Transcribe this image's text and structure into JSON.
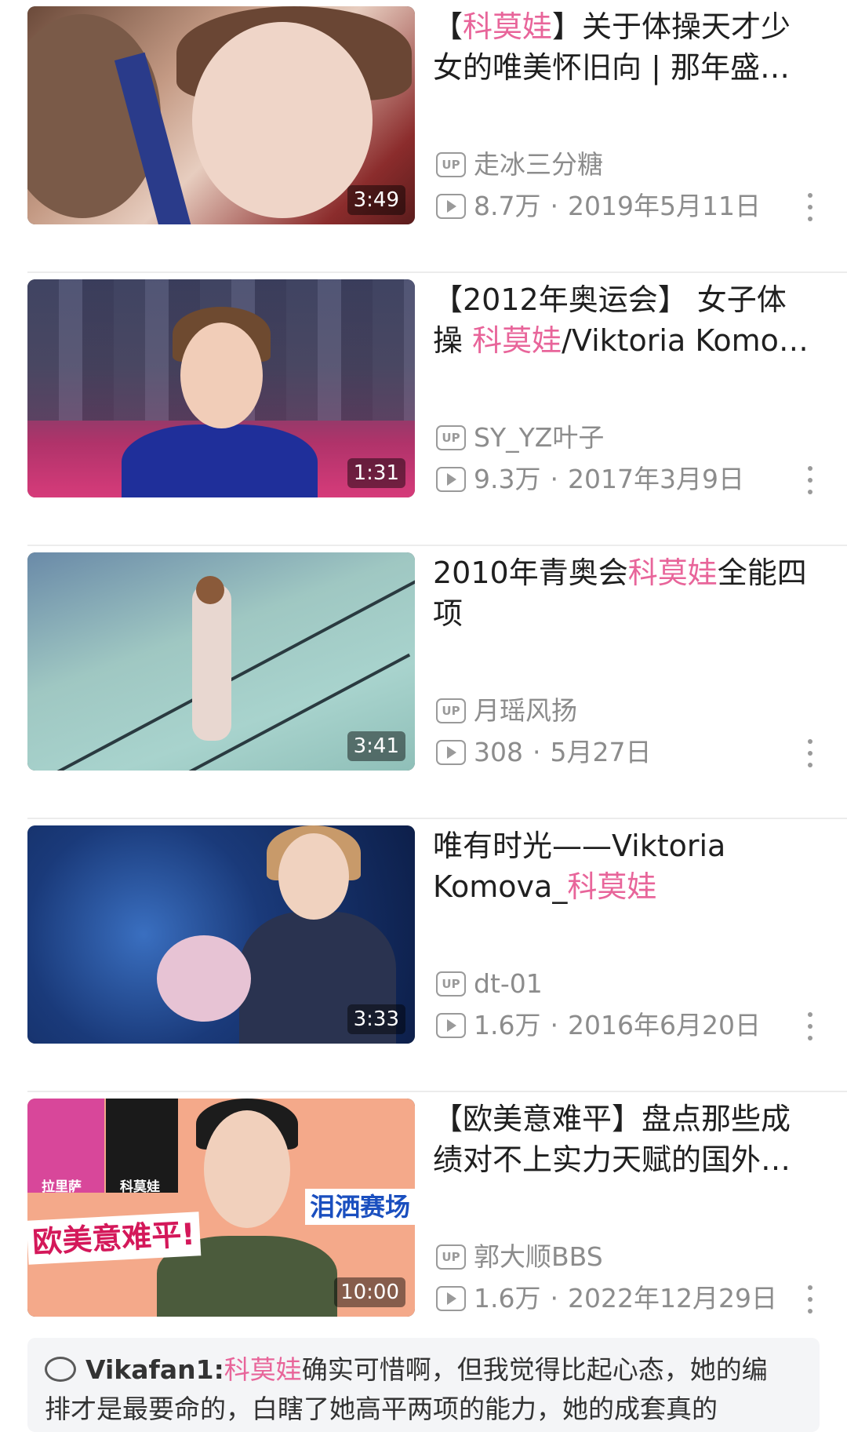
{
  "colors": {
    "highlight": "#e8659a",
    "meta_gray": "#8c8c8c",
    "comment_bg": "#f4f5f7"
  },
  "videos": [
    {
      "title_pre": "【",
      "title_hl": "科莫娃",
      "title_post": "】关于体操天才少",
      "title_line2": "女的唯美怀旧向 | 那年盛…",
      "duration": "3:49",
      "uploader": "走冰三分糖",
      "views": "8.7万",
      "date": "2019年5月11日"
    },
    {
      "title_pre": "【2012年奥运会】 女子体",
      "title_line2_pre": "操 ",
      "title_hl": "科莫娃",
      "title_line2_post": "/Viktoria Komo…",
      "duration": "1:31",
      "uploader": "SY_YZ叶子",
      "views": "9.3万",
      "date": "2017年3月9日"
    },
    {
      "title_pre": "2010年青奥会",
      "title_hl": "科莫娃",
      "title_post": "全能四",
      "title_line2": "项",
      "duration": "3:41",
      "uploader": "月瑶风扬",
      "views": "308",
      "date": "5月27日"
    },
    {
      "title_pre": "唯有时光——Viktoria",
      "title_line2_pre": "Komova_",
      "title_hl": "科莫娃",
      "duration": "3:33",
      "uploader": "dt-01",
      "views": "1.6万",
      "date": "2016年6月20日"
    },
    {
      "title_pre": "【欧美意难平】盘点那些成",
      "title_line2": "绩对不上实力天赋的国外…",
      "duration": "10:00",
      "uploader": "郭大顺BBS",
      "views": "1.6万",
      "date": "2022年12月29日",
      "thumb_text": {
        "banner": "欧美意难平!",
        "banner2": "泪洒赛场",
        "label1": "拉里萨",
        "label2": "科莫娃"
      }
    }
  ],
  "icons": {
    "up": "UP",
    "separator": "·"
  },
  "comment": {
    "user": "Vikafan1:",
    "hl": "科莫娃",
    "text": "确实可惜啊，但我觉得比起心态，她的编",
    "text_line2": "排才是最要命的，白瞎了她高平两项的能力，她的成套真的"
  }
}
